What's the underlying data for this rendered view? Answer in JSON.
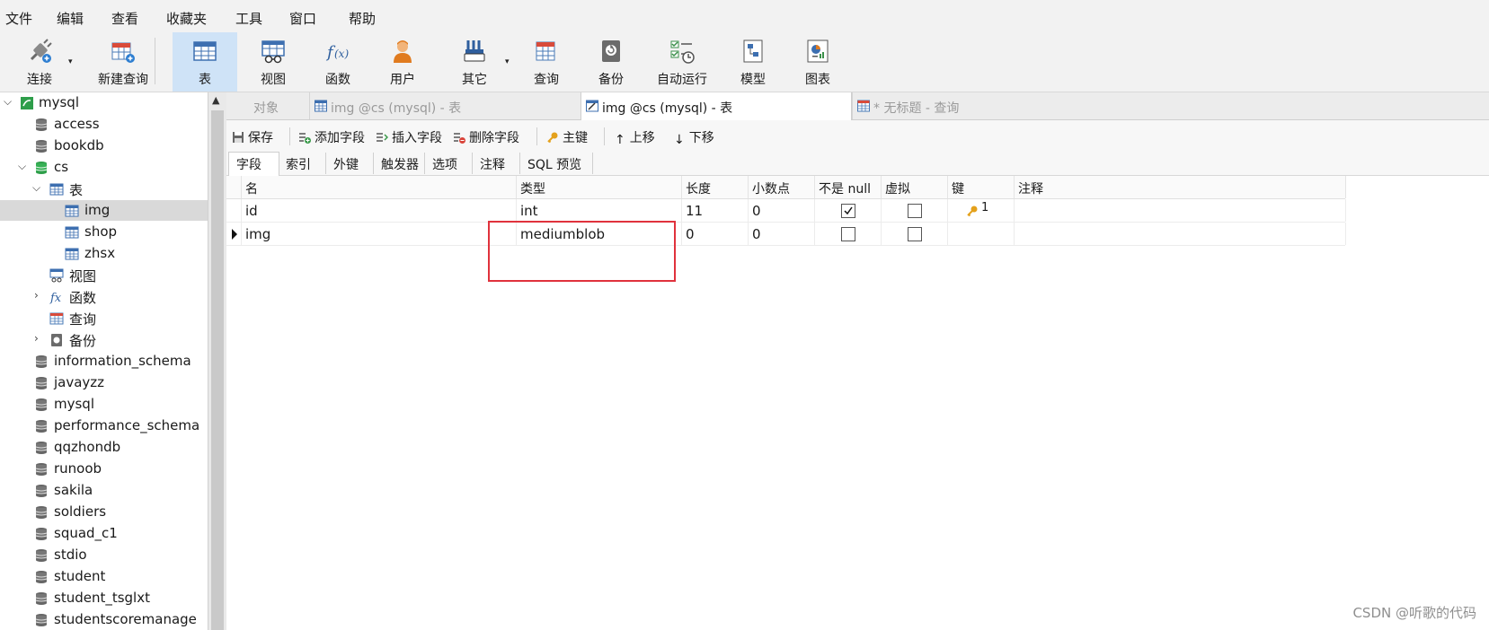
{
  "menu": [
    "文件",
    "编辑",
    "查看",
    "收藏夹",
    "工具",
    "窗口",
    "帮助"
  ],
  "toolbar": {
    "connect": "连接",
    "new_query": "新建查询",
    "table": "表",
    "view": "视图",
    "function": "函数",
    "user": "用户",
    "other": "其它",
    "query": "查询",
    "backup": "备份",
    "auto_run": "自动运行",
    "model": "模型",
    "chart": "图表"
  },
  "sidebar": {
    "root": "mysql",
    "items": [
      "access",
      "bookdb",
      "cs",
      "表",
      "img",
      "shop",
      "zhsx",
      "视图",
      "函数",
      "查询",
      "备份",
      "information_schema",
      "javayzz",
      "mysql",
      "performance_schema",
      "qqzhondb",
      "runoob",
      "sakila",
      "soldiers",
      "squad_c1",
      "stdio",
      "student",
      "student_tsglxt",
      "studentscoremanage"
    ]
  },
  "tabs": {
    "objects": "对象",
    "tab1": "img @cs (mysql) - 表",
    "tab2": "img @cs (mysql) - 表",
    "tab3": "* 无标题 - 查询"
  },
  "actions": {
    "save": "保存",
    "add_field": "添加字段",
    "insert_field": "插入字段",
    "delete_field": "删除字段",
    "primary_key": "主键",
    "move_up": "上移",
    "move_down": "下移"
  },
  "subtabs": [
    "字段",
    "索引",
    "外键",
    "触发器",
    "选项",
    "注释",
    "SQL 预览"
  ],
  "grid": {
    "headers": [
      "名",
      "类型",
      "长度",
      "小数点",
      "不是 null",
      "虚拟",
      "键",
      "注释"
    ],
    "rows": [
      {
        "name": "id",
        "type": "int",
        "length": "11",
        "decimal": "0",
        "not_null": true,
        "virtual": false,
        "key": "1",
        "comment": ""
      },
      {
        "name": "img",
        "type": "mediumblob",
        "length": "0",
        "decimal": "0",
        "not_null": false,
        "virtual": false,
        "key": "",
        "comment": ""
      }
    ]
  },
  "watermark": "CSDN @听歌的代码",
  "colors": {
    "accent": "#cfe3f7",
    "highlight": "#e0323c",
    "selected": "#d9d9d9"
  }
}
